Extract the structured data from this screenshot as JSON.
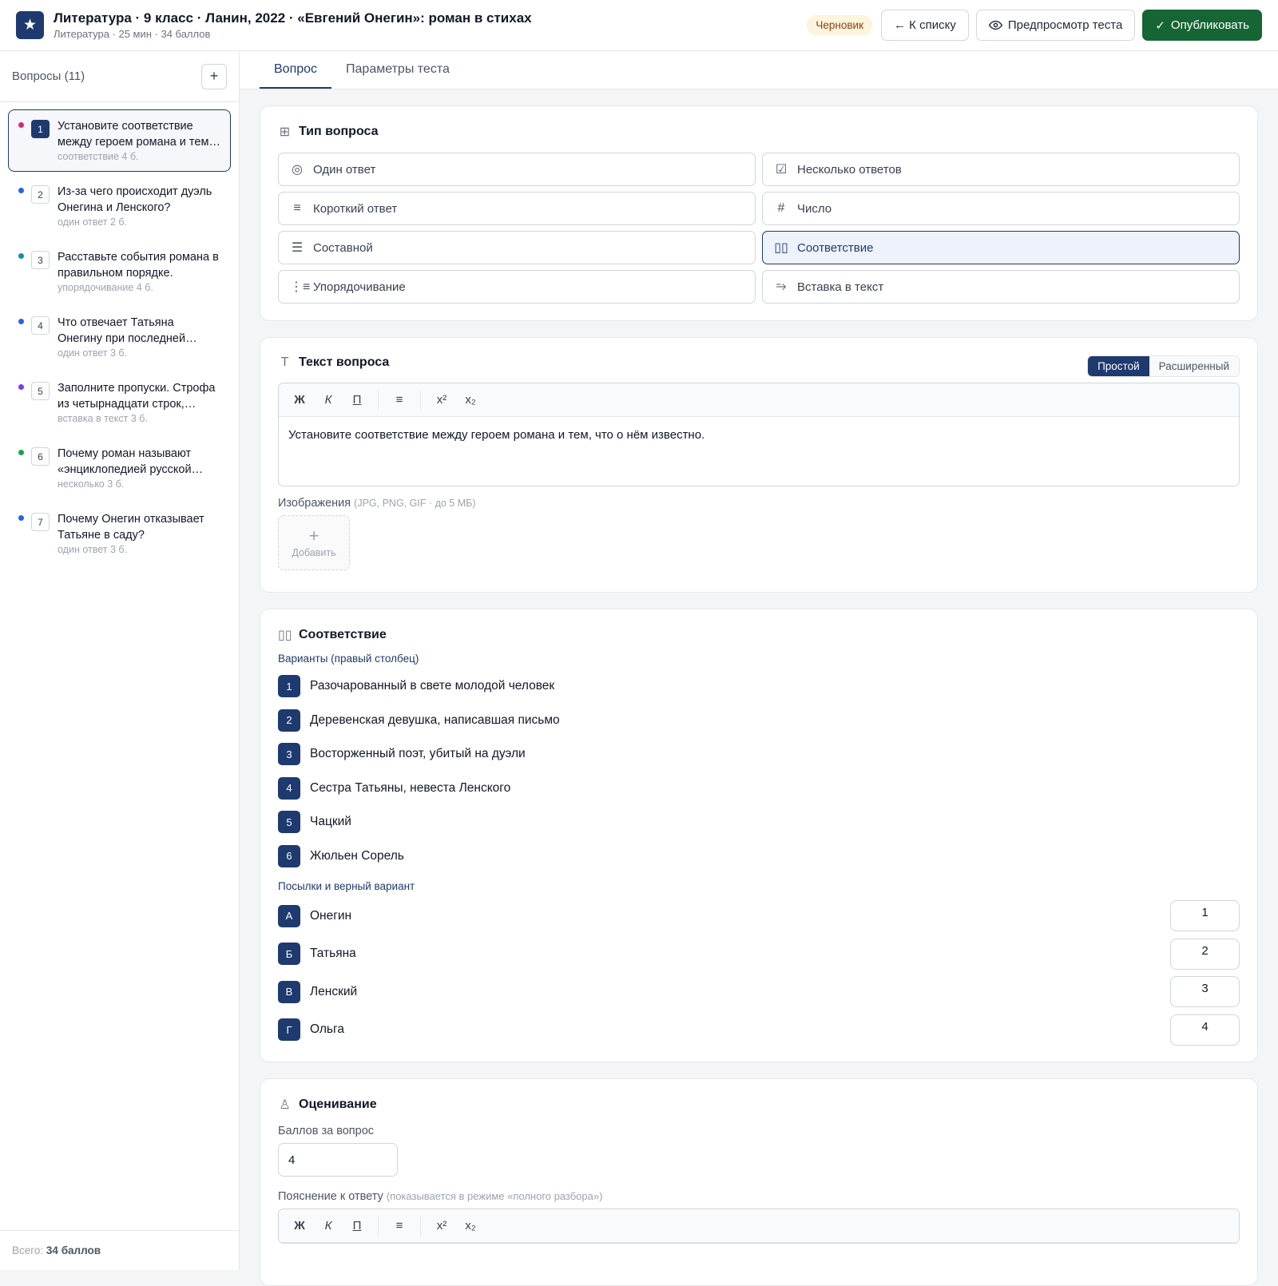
{
  "header": {
    "logo_icon": "star-icon",
    "title": "Литература · 9 класс · Ланин, 2022 · «Евгений Онегин»: роман в стихах",
    "subtitle": "Литература · 25 мин · 34 баллов",
    "status_badge": "Черновик",
    "back_button": "← К списку",
    "preview_button": "Предпросмотр теста",
    "publish_button": "Опубликовать",
    "colors": {
      "brand": "#1e3a6e",
      "publish": "#166534",
      "badge_bg": "#fdf4dd"
    }
  },
  "sidebar": {
    "heading": "Вопросы (11)",
    "add_label": "+",
    "items": [
      {
        "num": "1",
        "text": "Установите соответствие между героем романа и тем, что о нём известно.",
        "type": "соответствие",
        "points": "4 б.",
        "dot": "#db2777",
        "active": true
      },
      {
        "num": "2",
        "text": "Из-за чего происходит дуэль Онегина и Ленского?",
        "type": "один ответ",
        "points": "2 б.",
        "dot": "#2563eb",
        "active": false
      },
      {
        "num": "3",
        "text": "Расставьте события романа в правильном порядке.",
        "type": "упорядочивание",
        "points": "4 б.",
        "dot": "#0891b2",
        "active": false
      },
      {
        "num": "4",
        "text": "Что отвечает Татьяна Онегину при последней встрече?",
        "type": "один ответ",
        "points": "3 б.",
        "dot": "#2563eb",
        "active": false
      },
      {
        "num": "5",
        "text": "Заполните пропуски. Строфа из четырнадцати строк, которой написан роман.",
        "type": "вставка в текст",
        "points": "3 б.",
        "dot": "#7c3aed",
        "active": false
      },
      {
        "num": "6",
        "text": "Почему роман называют «энциклопедией русской жизни»?",
        "type": "несколько",
        "points": "3 б.",
        "dot": "#16a34a",
        "active": false
      },
      {
        "num": "7",
        "text": "Почему Онегин отказывает Татьяне в саду?",
        "type": "один ответ",
        "points": "3 б.",
        "dot": "#2563eb",
        "active": false
      }
    ],
    "footer_prefix": "Всего:",
    "footer_total": "34 баллов"
  },
  "tabs": [
    {
      "label": "Вопрос",
      "active": true
    },
    {
      "label": "Параметры теста",
      "active": false
    }
  ],
  "question_type": {
    "title": "Тип вопроса",
    "options": [
      {
        "label": "Один ответ",
        "icon": "radio-icon",
        "glyph": "◎",
        "active": false
      },
      {
        "label": "Несколько ответов",
        "icon": "checkbox-icon",
        "glyph": "☑",
        "active": false
      },
      {
        "label": "Короткий ответ",
        "icon": "lines-icon",
        "glyph": "≡",
        "active": false
      },
      {
        "label": "Число",
        "icon": "hash-icon",
        "glyph": "#",
        "active": false
      },
      {
        "label": "Составной",
        "icon": "list-icon",
        "glyph": "☰",
        "active": false
      },
      {
        "label": "Соответствие",
        "icon": "columns-icon",
        "glyph": "▯▯",
        "active": true
      },
      {
        "label": "Упорядочивание",
        "icon": "ordered-list-icon",
        "glyph": "⋮≡",
        "active": false
      },
      {
        "label": "Вставка в текст",
        "icon": "insert-text-icon",
        "glyph": "⥱",
        "active": false
      }
    ]
  },
  "question_text": {
    "title": "Текст вопроса",
    "mode_simple": "Простой",
    "mode_advanced": "Расширенный",
    "toolbar": {
      "bold": "Ж",
      "italic": "К",
      "underline": "П",
      "list": "≡",
      "sup": "x²",
      "sub": "x₂"
    },
    "body": "Установите соответствие между героем романа и тем, что о нём известно.",
    "images_label": "Изображения",
    "images_hint": "(JPG, PNG, GIF · до 5 МБ)",
    "add_image": "Добавить"
  },
  "matching": {
    "title": "Соответствие",
    "options_label": "Варианты (правый столбец)",
    "options": [
      {
        "key": "1",
        "text": "Разочарованный в свете молодой человек"
      },
      {
        "key": "2",
        "text": "Деревенская девушка, написавшая письмо"
      },
      {
        "key": "3",
        "text": "Восторженный поэт, убитый на дуэли"
      },
      {
        "key": "4",
        "text": "Сестра Татьяны, невеста Ленского"
      },
      {
        "key": "5",
        "text": "Чацкий"
      },
      {
        "key": "6",
        "text": "Жюльен Сорель"
      }
    ],
    "premises_label": "Посылки и верный вариант",
    "premises": [
      {
        "key": "А",
        "text": "Онегин",
        "answer": "1"
      },
      {
        "key": "Б",
        "text": "Татьяна",
        "answer": "2"
      },
      {
        "key": "В",
        "text": "Ленский",
        "answer": "3"
      },
      {
        "key": "Г",
        "text": "Ольга",
        "answer": "4"
      }
    ]
  },
  "grading": {
    "title": "Оценивание",
    "points_label": "Баллов за вопрос",
    "points_value": "4",
    "explanation_label": "Пояснение к ответу",
    "explanation_hint": "(показывается в режиме «полного разбора»)"
  }
}
